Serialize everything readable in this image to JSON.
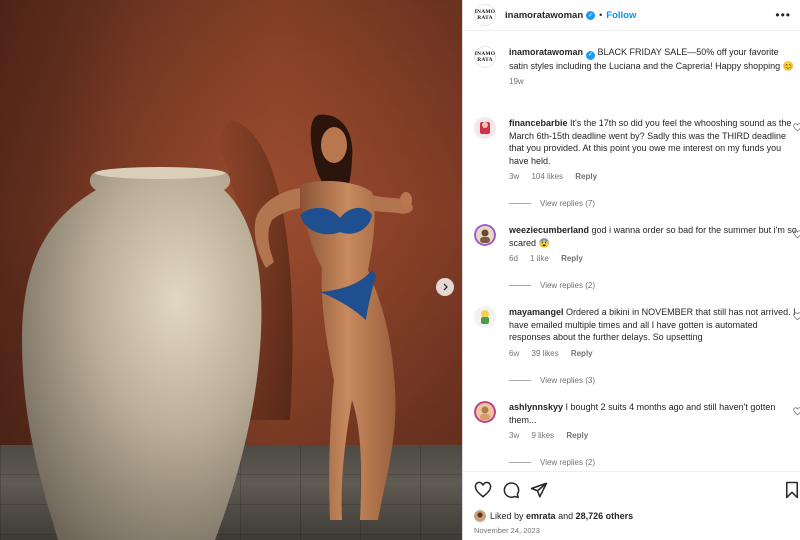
{
  "account": {
    "username": "inamoratawoman",
    "logo_text": [
      "INAMO",
      "RATA"
    ],
    "follow_label": "Follow",
    "separator": "•",
    "more_label": "•••"
  },
  "caption": {
    "username": "inamoratawoman",
    "text": "BLACK FRIDAY SALE—50% off your favorite satin styles including the Luciana and the Capreria! Happy shopping 😊",
    "time": "19w"
  },
  "comments": [
    {
      "username": "financebarbie",
      "text": "It's the 17th so did you feel the whooshing sound as the March 6th-15th deadline went by? Sadly this was the THIRD deadline that you provided. At this point you owe me interest on my funds you have held.",
      "time": "3w",
      "likes": "104 likes",
      "reply_label": "Reply",
      "view_replies": "View replies (7)"
    },
    {
      "username": "weeziecumberland",
      "text": "god i wanna order so bad for the summer but i'm so scared 😨",
      "time": "6d",
      "likes": "1 like",
      "reply_label": "Reply",
      "view_replies": "View replies (2)"
    },
    {
      "username": "mayamangel",
      "text": "Ordered a bikini in NOVEMBER that still has not arrived. I have emailed multiple times and all I have gotten is automated responses about the further delays. So upsetting",
      "time": "6w",
      "likes": "39 likes",
      "reply_label": "Reply",
      "view_replies": "View replies (3)"
    },
    {
      "username": "ashlynnskyy",
      "text": "I bought 2 suits 4 months ago and still haven't gotten them...",
      "time": "3w",
      "likes": "9 likes",
      "reply_label": "Reply",
      "view_replies": "View replies (2)"
    }
  ],
  "likes": {
    "prefix": "Liked by",
    "user": "emrata",
    "middle": "and",
    "others": "28,726 others"
  },
  "date": "November 24, 2023",
  "colors": {
    "accent": "#0095f6",
    "verified": "#1d9bf0",
    "muted": "#737373"
  },
  "icons": [
    "heart-icon",
    "comment-icon",
    "share-icon",
    "bookmark-icon",
    "chevron-right-icon",
    "more-icon"
  ]
}
